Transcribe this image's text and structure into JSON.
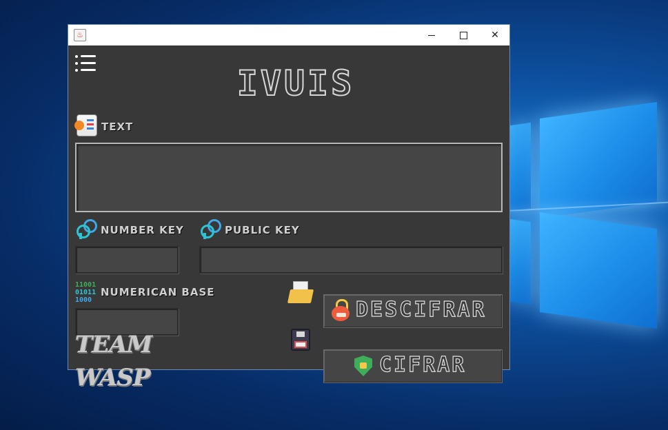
{
  "window": {
    "controls": {
      "minimize": "–",
      "maximize": "☐",
      "close": "✕"
    }
  },
  "app": {
    "title": "IVUIS",
    "labels": {
      "text": "TEXT",
      "number_key": "NUMBER KEY",
      "public_key": "PUBLIC KEY",
      "numerican_base": "NUMERICAN BASE"
    },
    "fields": {
      "text_value": "",
      "number_key_value": "",
      "public_key_value": "",
      "numerican_base_value": ""
    },
    "buttons": {
      "descifrar": "DESCIFRAR",
      "cifrar": "CIFRAR"
    },
    "binary_icon_text": [
      "11001",
      "01011",
      "1000"
    ],
    "team_logo": "TEAM WASP"
  },
  "colors": {
    "window_bg": "#383838",
    "field_bg": "#454545",
    "icon_cyan": "#2fc4d4",
    "shield_green": "#3fae5b"
  }
}
